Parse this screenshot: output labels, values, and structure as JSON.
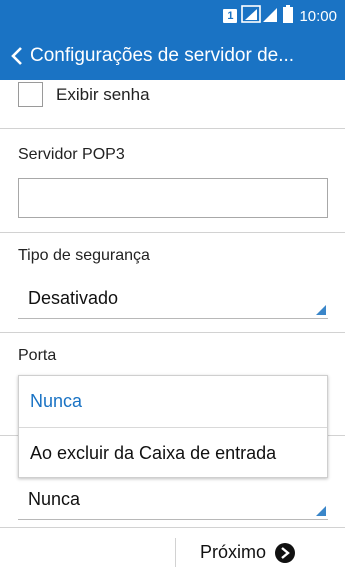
{
  "status_bar": {
    "sim_number": "1",
    "time": "10:00",
    "icons": [
      "sim-icon",
      "signal-icon",
      "battery-icon"
    ]
  },
  "header": {
    "title": "Configurações de servidor de..."
  },
  "checkbox": {
    "label": "Exibir senha",
    "checked": false
  },
  "pop3": {
    "label": "Servidor POP3",
    "value": ""
  },
  "security": {
    "label": "Tipo de segurança",
    "value": "Desativado"
  },
  "port": {
    "label": "Porta"
  },
  "dropdown": {
    "items": [
      "Nunca",
      "Ao excluir da Caixa de entrada"
    ],
    "selected_index": 0
  },
  "delete_select": {
    "value": "Nunca"
  },
  "footer": {
    "next_label": "Próximo"
  },
  "colors": {
    "accent": "#1a73c4",
    "select_arrow": "#3a86c9"
  }
}
